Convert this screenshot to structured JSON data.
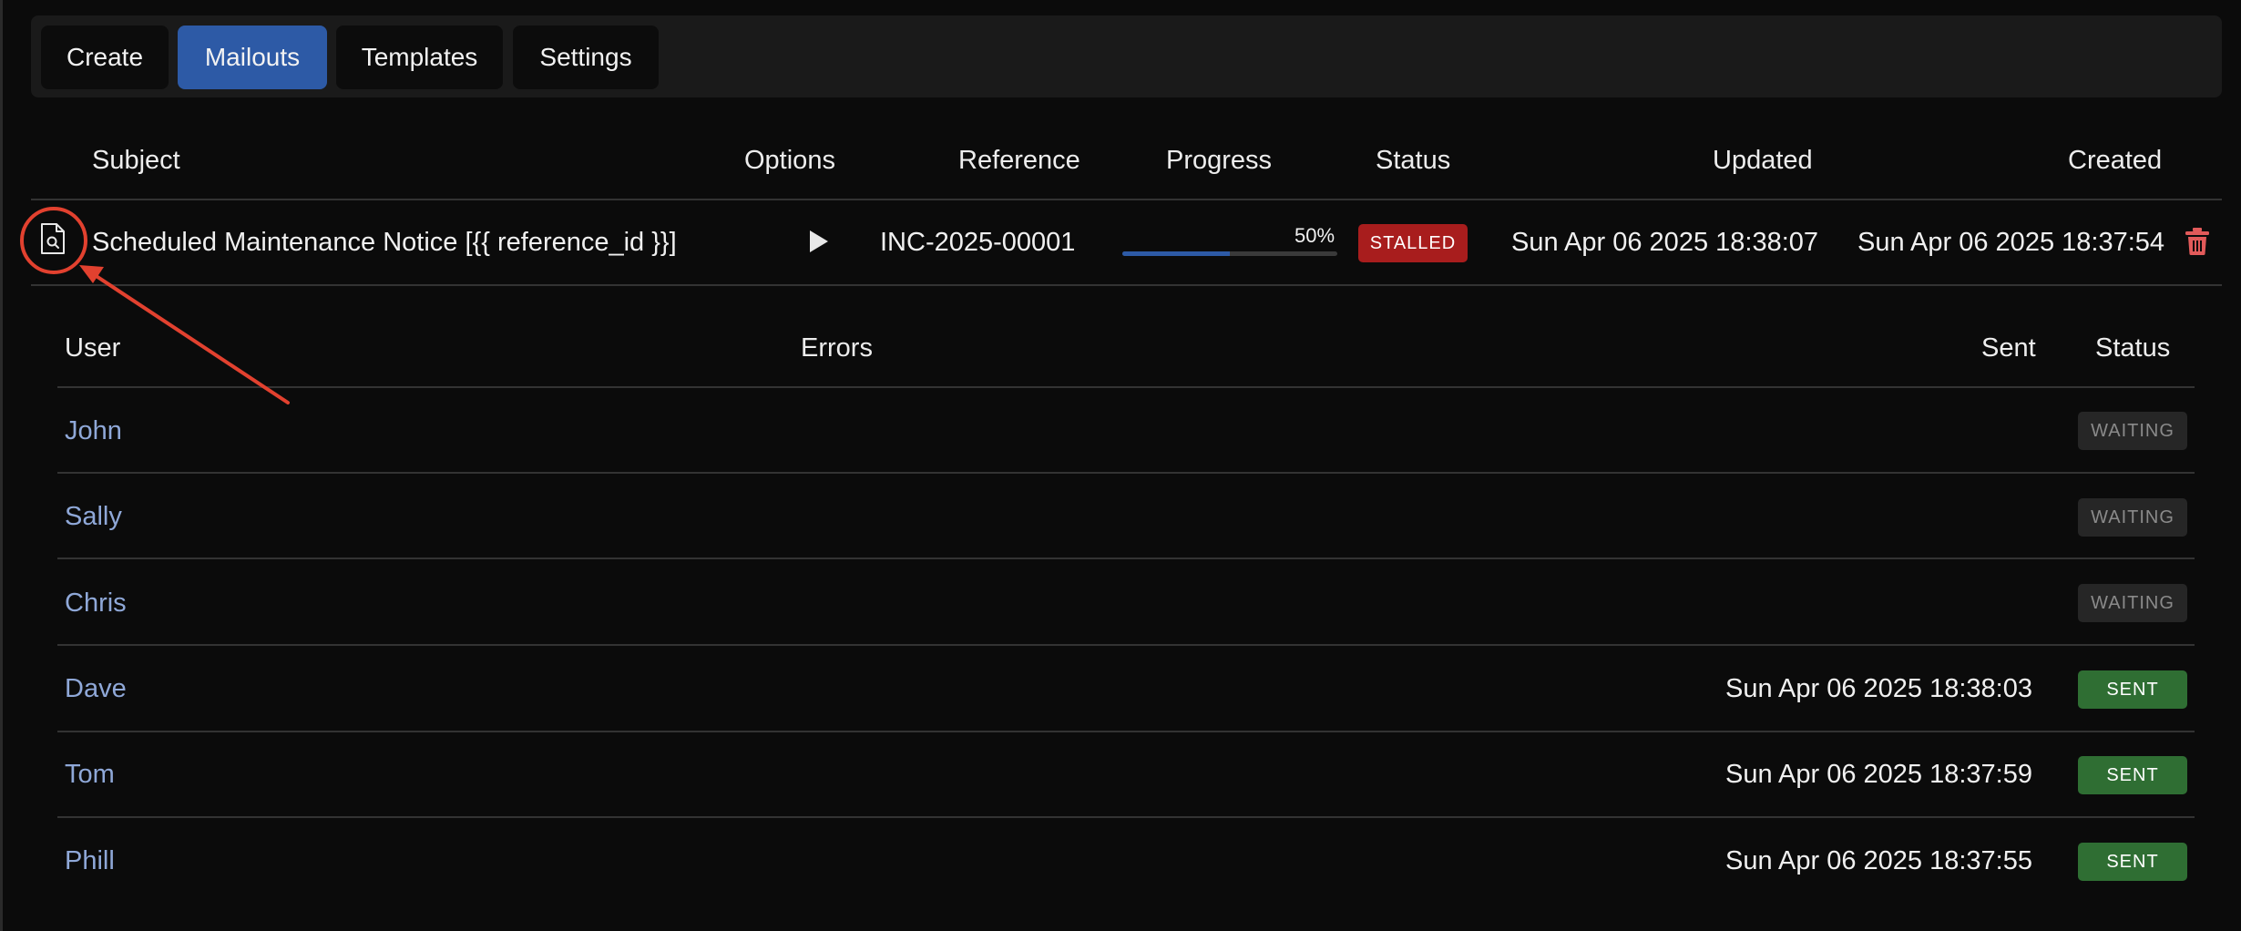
{
  "tabs": [
    {
      "label": "Create",
      "active": false
    },
    {
      "label": "Mailouts",
      "active": true
    },
    {
      "label": "Templates",
      "active": false
    },
    {
      "label": "Settings",
      "active": false
    }
  ],
  "mailouts_table": {
    "headers": {
      "subject": "Subject",
      "options": "Options",
      "reference": "Reference",
      "progress": "Progress",
      "status": "Status",
      "updated": "Updated",
      "created": "Created"
    },
    "row": {
      "subject": "Scheduled Maintenance Notice [{{ reference_id }}]",
      "reference": "INC-2025-00001",
      "progress_percent": 50,
      "progress_label": "50%",
      "status": "STALLED",
      "updated": "Sun Apr 06 2025 18:38:07",
      "created": "Sun Apr 06 2025 18:37:54"
    }
  },
  "recipients_table": {
    "headers": {
      "user": "User",
      "errors": "Errors",
      "sent": "Sent",
      "status": "Status"
    },
    "rows": [
      {
        "user": "John",
        "errors": "",
        "sent": "",
        "status": "WAITING"
      },
      {
        "user": "Sally",
        "errors": "",
        "sent": "",
        "status": "WAITING"
      },
      {
        "user": "Chris",
        "errors": "",
        "sent": "",
        "status": "WAITING"
      },
      {
        "user": "Dave",
        "errors": "",
        "sent": "Sun Apr 06 2025 18:38:03",
        "status": "SENT"
      },
      {
        "user": "Tom",
        "errors": "",
        "sent": "Sun Apr 06 2025 18:37:59",
        "status": "SENT"
      },
      {
        "user": "Phill",
        "errors": "",
        "sent": "Sun Apr 06 2025 18:37:55",
        "status": "SENT"
      }
    ]
  },
  "icons": {
    "preview": "file-search-icon",
    "options": "play-icon",
    "delete": "trash-icon"
  },
  "colors": {
    "accent": "#2d5aa6",
    "stalled": "#a81d1d",
    "sent": "#2f6e33",
    "waiting": "#262626",
    "annotation": "#e2412f"
  }
}
